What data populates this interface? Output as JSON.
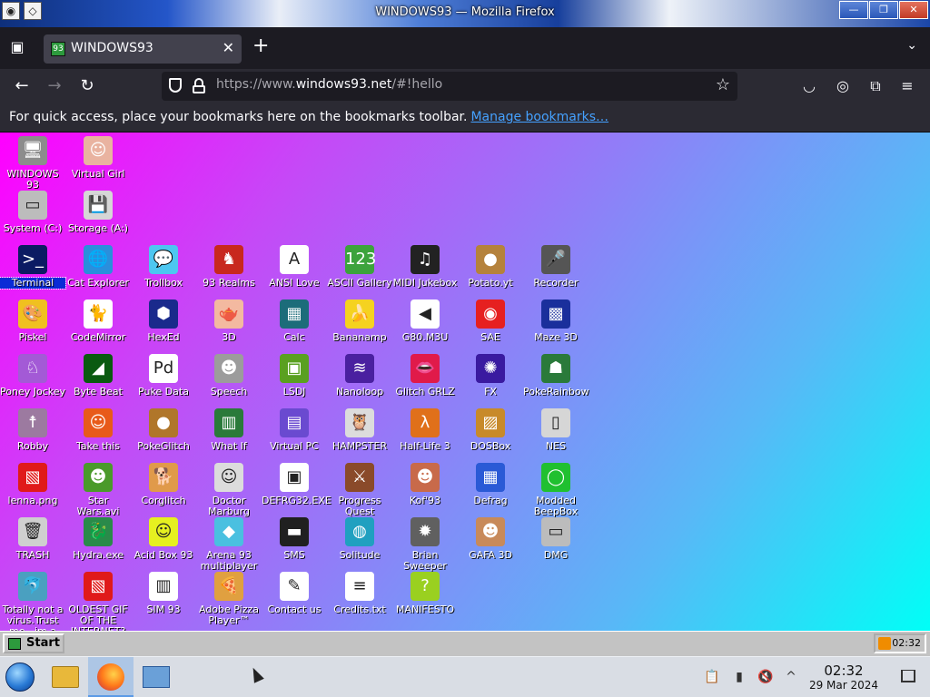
{
  "window": {
    "title": "WINDOWS93 — Mozilla Firefox"
  },
  "tab": {
    "title": "WINDOWS93"
  },
  "address": {
    "url_prefix": "https://www.",
    "url_domain": "windows93.net",
    "url_path": "/#!hello"
  },
  "bookmarks": {
    "message": "For quick access, place your bookmarks here on the bookmarks toolbar.",
    "link": "Manage bookmarks…"
  },
  "desktop_icons": [
    {
      "label": "WINDOWS 93",
      "color": "#8c8c8c",
      "glyph": "🖥"
    },
    {
      "label": "Virtual Girl",
      "color": "#e9b3a0",
      "glyph": "☺"
    },
    {
      "label": "System (C:)",
      "color": "#bcbcbc",
      "glyph": "▭"
    },
    {
      "label": "Storage (A:)",
      "color": "#d6d6d6",
      "glyph": "💾"
    },
    {
      "label": "Terminal",
      "color": "#0b1b63",
      "glyph": ">_"
    },
    {
      "label": "Cat Explorer",
      "color": "#2a8fdc",
      "glyph": "🌐"
    },
    {
      "label": "Trollbox",
      "color": "#4dc7f0",
      "glyph": "💬"
    },
    {
      "label": "93 Realms",
      "color": "#c8281e",
      "glyph": "♞"
    },
    {
      "label": "ANSI Love",
      "color": "#ffffff",
      "glyph": "A"
    },
    {
      "label": "ASCII Gallery",
      "color": "#3ca33c",
      "glyph": "123"
    },
    {
      "label": "MIDI Jukebox",
      "color": "#222222",
      "glyph": "♫"
    },
    {
      "label": "Potato.yt",
      "color": "#b5823c",
      "glyph": "●"
    },
    {
      "label": "Recorder",
      "color": "#555555",
      "glyph": "🎤"
    },
    {
      "label": "Piskel",
      "color": "#f0c020",
      "glyph": "🎨"
    },
    {
      "label": "CodeMirror",
      "color": "#ffffff",
      "glyph": "🐈"
    },
    {
      "label": "HexEd",
      "color": "#1a2a8c",
      "glyph": "⬢"
    },
    {
      "label": "3D",
      "color": "#f3b9a0",
      "glyph": "🫖"
    },
    {
      "label": "Calc",
      "color": "#1c6c7a",
      "glyph": "▦"
    },
    {
      "label": "Bananamp",
      "color": "#f5d220",
      "glyph": "🍌"
    },
    {
      "label": "G80.M3U",
      "color": "#ffffff",
      "glyph": "◀"
    },
    {
      "label": "SAE",
      "color": "#e62020",
      "glyph": "◉"
    },
    {
      "label": "Maze 3D",
      "color": "#1a2f9c",
      "glyph": "▩"
    },
    {
      "label": "Poney Jockey",
      "color": "#a35ad6",
      "glyph": "♘"
    },
    {
      "label": "Byte Beat",
      "color": "#0a5a10",
      "glyph": "◢"
    },
    {
      "label": "Puke Data",
      "color": "#ffffff",
      "glyph": "Pd"
    },
    {
      "label": "Speech",
      "color": "#9c9c9c",
      "glyph": "☻"
    },
    {
      "label": "LSDJ",
      "color": "#5aa020",
      "glyph": "▣"
    },
    {
      "label": "Nanoloop",
      "color": "#4a20a0",
      "glyph": "≋"
    },
    {
      "label": "Glitch GRLZ",
      "color": "#e01a4a",
      "glyph": "👄"
    },
    {
      "label": "FX",
      "color": "#3a1aa0",
      "glyph": "✺"
    },
    {
      "label": "PokeRainbow",
      "color": "#2a7a3a",
      "glyph": "☗"
    },
    {
      "label": "Robby",
      "color": "#9c7aa0",
      "glyph": "☨"
    },
    {
      "label": "Take this",
      "color": "#e85a1a",
      "glyph": "☺"
    },
    {
      "label": "PokeGlitch",
      "color": "#b0762a",
      "glyph": "●"
    },
    {
      "label": "What If",
      "color": "#2a7a3a",
      "glyph": "▥"
    },
    {
      "label": "Virtual PC",
      "color": "#6a4ad0",
      "glyph": "▤"
    },
    {
      "label": "HAMPSTER",
      "color": "#dcdcdc",
      "glyph": "🦉"
    },
    {
      "label": "Half-Life 3",
      "color": "#e0701a",
      "glyph": "λ"
    },
    {
      "label": "DOSBox",
      "color": "#c88a2a",
      "glyph": "▨"
    },
    {
      "label": "NES",
      "color": "#d6d6d6",
      "glyph": "▯"
    },
    {
      "label": "lenna.png",
      "color": "#e01a1a",
      "glyph": "▧"
    },
    {
      "label": "Star Wars.avi",
      "color": "#4a9a2a",
      "glyph": "☻"
    },
    {
      "label": "Corglitch",
      "color": "#e09a4a",
      "glyph": "🐕"
    },
    {
      "label": "Doctor Marburg",
      "color": "#dcdcdc",
      "glyph": "☺"
    },
    {
      "label": "DEFRG32.EXE",
      "color": "#ffffff",
      "glyph": "▣"
    },
    {
      "label": "Progress Quest",
      "color": "#8a4a2a",
      "glyph": "⚔"
    },
    {
      "label": "Kof'93",
      "color": "#c86a4a",
      "glyph": "☻"
    },
    {
      "label": "Defrag",
      "color": "#2a5ad6",
      "glyph": "▦"
    },
    {
      "label": "Modded BeepBox",
      "color": "#20c030",
      "glyph": "◯"
    },
    {
      "label": "TRASH",
      "color": "#cfcfcf",
      "glyph": "🗑"
    },
    {
      "label": "Hydra.exe",
      "color": "#2a8a4a",
      "glyph": "🐉"
    },
    {
      "label": "Acid Box 93",
      "color": "#e6f020",
      "glyph": "☺"
    },
    {
      "label": "Arena 93 multiplayer",
      "color": "#4ac0e0",
      "glyph": "◆"
    },
    {
      "label": "SMS",
      "color": "#202020",
      "glyph": "▬"
    },
    {
      "label": "Solitude",
      "color": "#20a0c0",
      "glyph": "◍"
    },
    {
      "label": "Brian Sweeper",
      "color": "#606060",
      "glyph": "✹"
    },
    {
      "label": "GAFA 3D",
      "color": "#c88a5a",
      "glyph": "☻"
    },
    {
      "label": "DMG",
      "color": "#bcbcbc",
      "glyph": "▭"
    },
    {
      "label": "Totally not a virus.Trust me...im a dolphin",
      "color": "#4aa0c0",
      "glyph": "🐬"
    },
    {
      "label": "OLDEST GIF OF THE INTERNET?",
      "color": "#e01a1a",
      "glyph": "▧"
    },
    {
      "label": "SIM 93",
      "color": "#ffffff",
      "glyph": "▥"
    },
    {
      "label": "Adobe Pizza Player™",
      "color": "#e0a040",
      "glyph": "🍕"
    },
    {
      "label": "Contact us",
      "color": "#ffffff",
      "glyph": "✎"
    },
    {
      "label": "Credits.txt",
      "color": "#ffffff",
      "glyph": "≡"
    },
    {
      "label": "MANIFESTO",
      "color": "#9ad020",
      "glyph": "?"
    }
  ],
  "win93_taskbar": {
    "start_label": "Start",
    "time": "02:32"
  },
  "host_taskbar": {
    "time": "02:32",
    "date": "29 Mar 2024"
  },
  "colors": {
    "firefox_dark": "#1c1b22",
    "toolbar": "#2b2a33",
    "link": "#45a1ff"
  }
}
